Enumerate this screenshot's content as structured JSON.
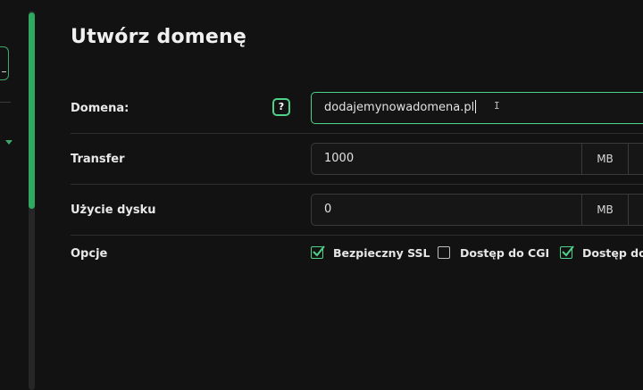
{
  "page": {
    "title": "Utwórz domenę"
  },
  "form": {
    "domain": {
      "label": "Domena:",
      "help_symbol": "?",
      "value": "dodajemynowadomena.pl"
    },
    "transfer": {
      "label": "Transfer",
      "value": "1000",
      "unit": "MB"
    },
    "disk_usage": {
      "label": "Użycie dysku",
      "value": "0",
      "unit": "MB"
    },
    "options": {
      "label": "Opcje",
      "items": [
        {
          "label": "Bezpieczny SSL",
          "checked": true
        },
        {
          "label": "Dostęp do CGI",
          "checked": false
        },
        {
          "label": "Dostęp do P",
          "checked": true
        }
      ]
    }
  },
  "colors": {
    "accent": "#4fd18a",
    "scrollbar": "#2fa860",
    "background": "#121212"
  }
}
